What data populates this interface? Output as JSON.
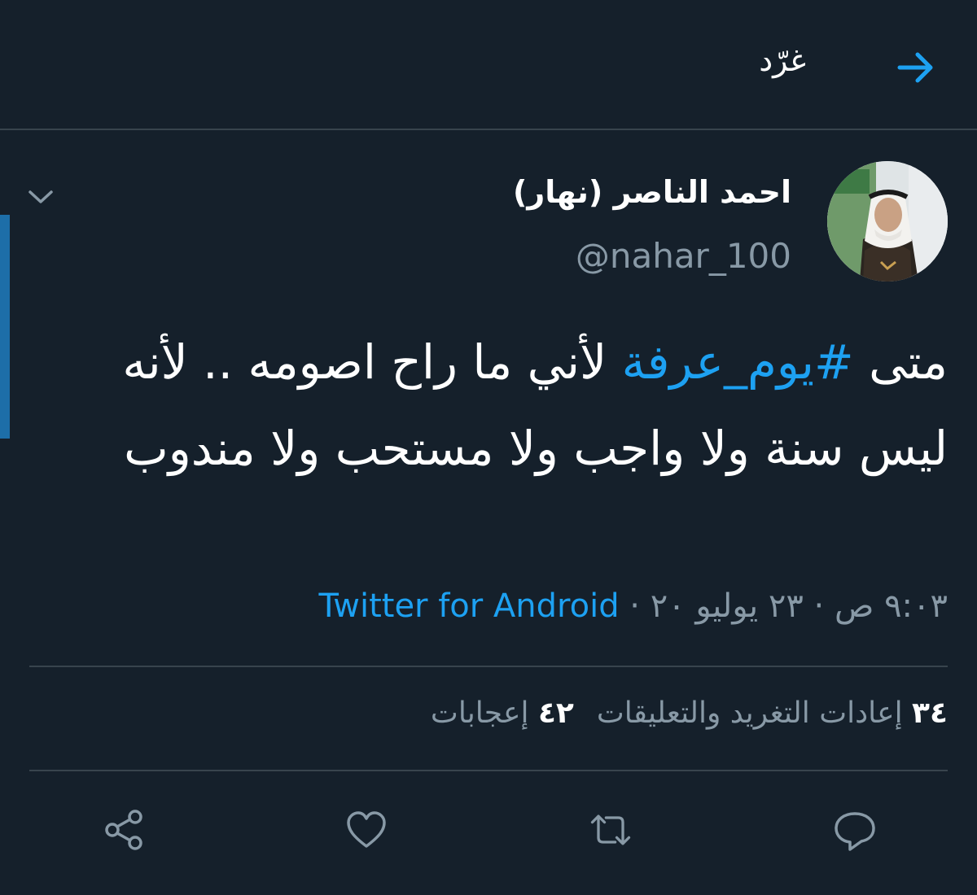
{
  "header": {
    "title": "غرّد",
    "back_icon": "arrow-right-icon"
  },
  "tweet": {
    "author": {
      "name": "احمد الناصر (نهار)",
      "handle": "@nahar_100",
      "avatar_icon": "avatar-image"
    },
    "text": {
      "before_hashtag": "متى ",
      "hashtag": "#يوم_عرفة",
      "after_hashtag": " لأني ما راح اصومه .. لأنه ليس سنة ولا واجب ولا مستحب ولا مندوب"
    },
    "meta": {
      "time": "٩:٠٣ ص",
      "sep1": " · ",
      "date": "٢٣ يوليو ٢٠",
      "sep2": " · ",
      "source": "Twitter for Android"
    },
    "stats": {
      "retweets_count": "٣٤",
      "retweets_label": "إعادات التغريد والتعليقات",
      "likes_count": "٤٢",
      "likes_label": "إعجابات"
    }
  },
  "actions": [
    {
      "icon": "reply-icon"
    },
    {
      "icon": "retweet-icon"
    },
    {
      "icon": "like-icon"
    },
    {
      "icon": "share-icon"
    }
  ],
  "colors": {
    "background": "#15202b",
    "accent": "#1da1f2",
    "muted": "#8899a6",
    "divider": "#38444d"
  }
}
